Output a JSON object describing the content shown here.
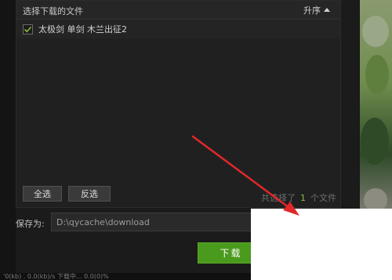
{
  "panel": {
    "title": "选择下载的文件",
    "sort_label": "升序",
    "files": [
      {
        "name": "太极剑 单剑 木兰出征2",
        "checked": true
      }
    ],
    "select_all_label": "全选",
    "invert_label": "反选",
    "summary_prefix": "共选择了",
    "summary_count": "1",
    "summary_suffix": "个文件"
  },
  "save": {
    "label": "保存为:",
    "path": "D:\\qycache\\download"
  },
  "download_label": "下载",
  "status_text": "'0(kb) . 0.0(kb)/s 下载中... 0.0(0)%",
  "colors": {
    "accent_green": "#4a9a1d",
    "count_green": "#8bbf3c",
    "arrow_red": "#e0282a"
  },
  "icons": [
    "caret-up-icon",
    "check-icon",
    "arrow-icon"
  ]
}
